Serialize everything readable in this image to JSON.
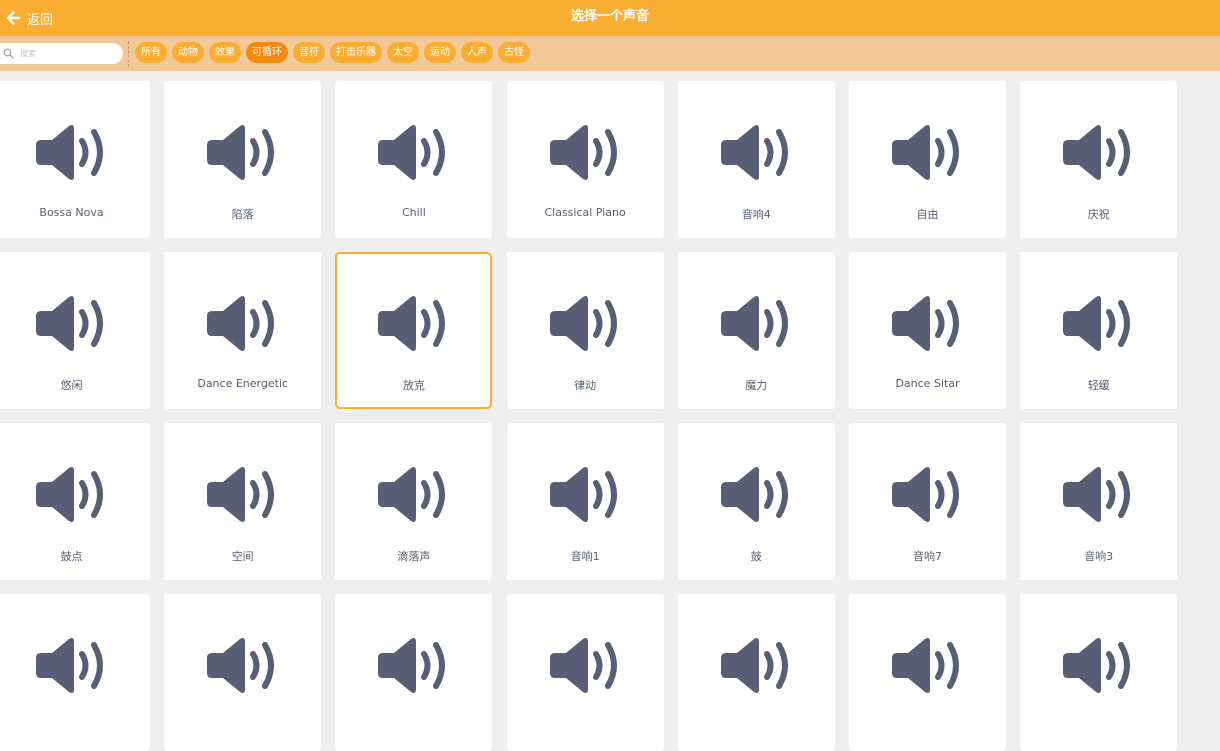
{
  "header": {
    "back_label": "返回",
    "title": "选择一个声音"
  },
  "search": {
    "placeholder": "搜索",
    "value": ""
  },
  "tags": [
    {
      "label": "所有",
      "active": false
    },
    {
      "label": "动物",
      "active": false
    },
    {
      "label": "效果",
      "active": false
    },
    {
      "label": "可循环",
      "active": true
    },
    {
      "label": "音符",
      "active": false
    },
    {
      "label": "打击乐器",
      "active": false
    },
    {
      "label": "太空",
      "active": false
    },
    {
      "label": "运动",
      "active": false
    },
    {
      "label": "人声",
      "active": false
    },
    {
      "label": "古怪",
      "active": false
    }
  ],
  "sounds": [
    {
      "name": "Bossa Nova"
    },
    {
      "name": "陷落"
    },
    {
      "name": "Chill"
    },
    {
      "name": "Classical Piano"
    },
    {
      "name": "音响4"
    },
    {
      "name": "自由"
    },
    {
      "name": "庆祝"
    },
    {
      "name": "悠闲"
    },
    {
      "name": "Dance Energetic"
    },
    {
      "name": "放克",
      "selected": true
    },
    {
      "name": "律动"
    },
    {
      "name": "魔力"
    },
    {
      "name": "Dance Sitar"
    },
    {
      "name": "轻缓"
    },
    {
      "name": "鼓点"
    },
    {
      "name": "空间"
    },
    {
      "name": "滴落声"
    },
    {
      "name": "音响1"
    },
    {
      "name": "鼓"
    },
    {
      "name": "音响7"
    },
    {
      "name": "音响3"
    },
    {
      "name": ""
    },
    {
      "name": ""
    },
    {
      "name": ""
    },
    {
      "name": ""
    },
    {
      "name": ""
    },
    {
      "name": ""
    },
    {
      "name": ""
    }
  ],
  "colors": {
    "header": "#f9ae31",
    "filter_bar": "#f3c898",
    "tag": "#f9ae31",
    "tag_active": "#f58a12",
    "icon": "#575e75",
    "background": "#efefef"
  }
}
